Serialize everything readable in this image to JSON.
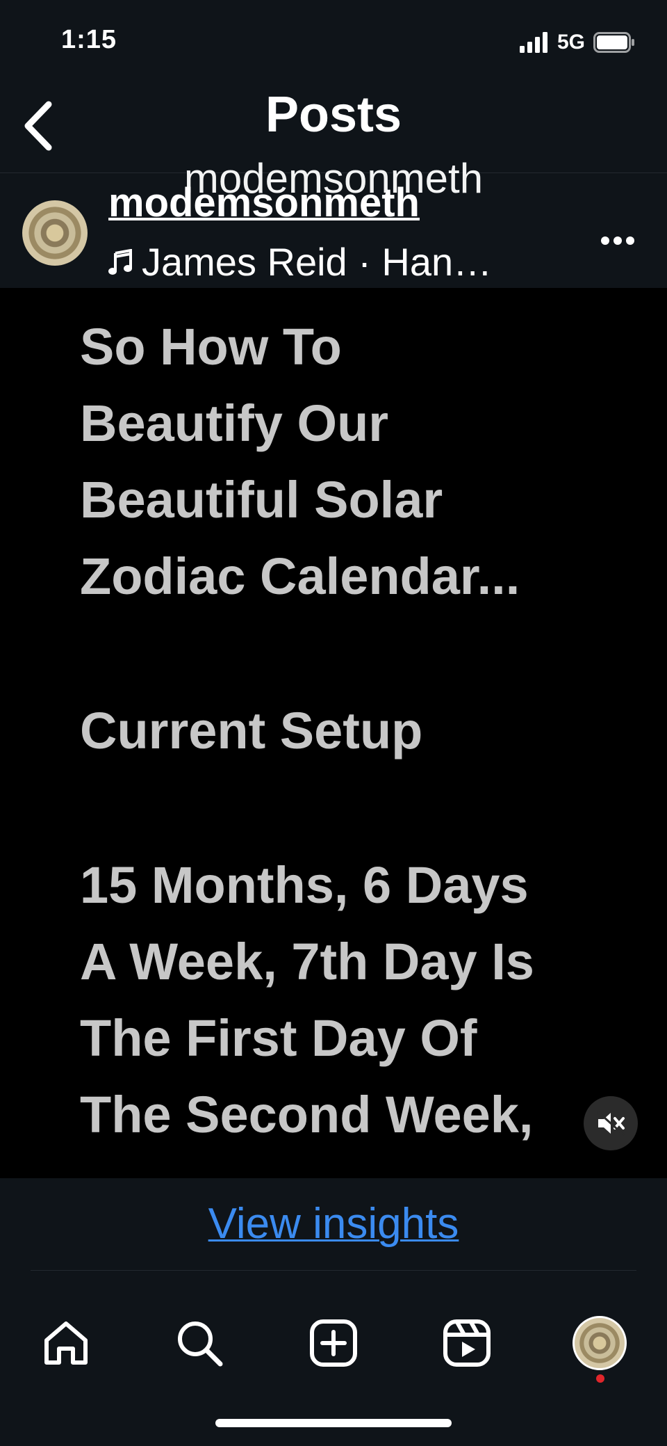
{
  "status_bar": {
    "time": "1:15",
    "network": "5G"
  },
  "header": {
    "title": "Posts"
  },
  "post": {
    "ghost_username": "modemsonmeth",
    "username": "modemsonmeth",
    "music": "James Reid · Han…",
    "media_lines": [
      "So How To",
      "Beautify Our",
      "Beautiful Solar",
      "Zodiac Calendar...",
      "Current Setup",
      "15 Months, 6 Days",
      "A Week, 7th Day Is",
      "The First Day Of",
      "The Second Week,"
    ]
  },
  "insights": {
    "label": "View insights"
  },
  "colors": {
    "background": "#0f1419",
    "link": "#3b8bf0",
    "media_text": "#c7c7c7",
    "notification_dot": "#e0262b"
  }
}
